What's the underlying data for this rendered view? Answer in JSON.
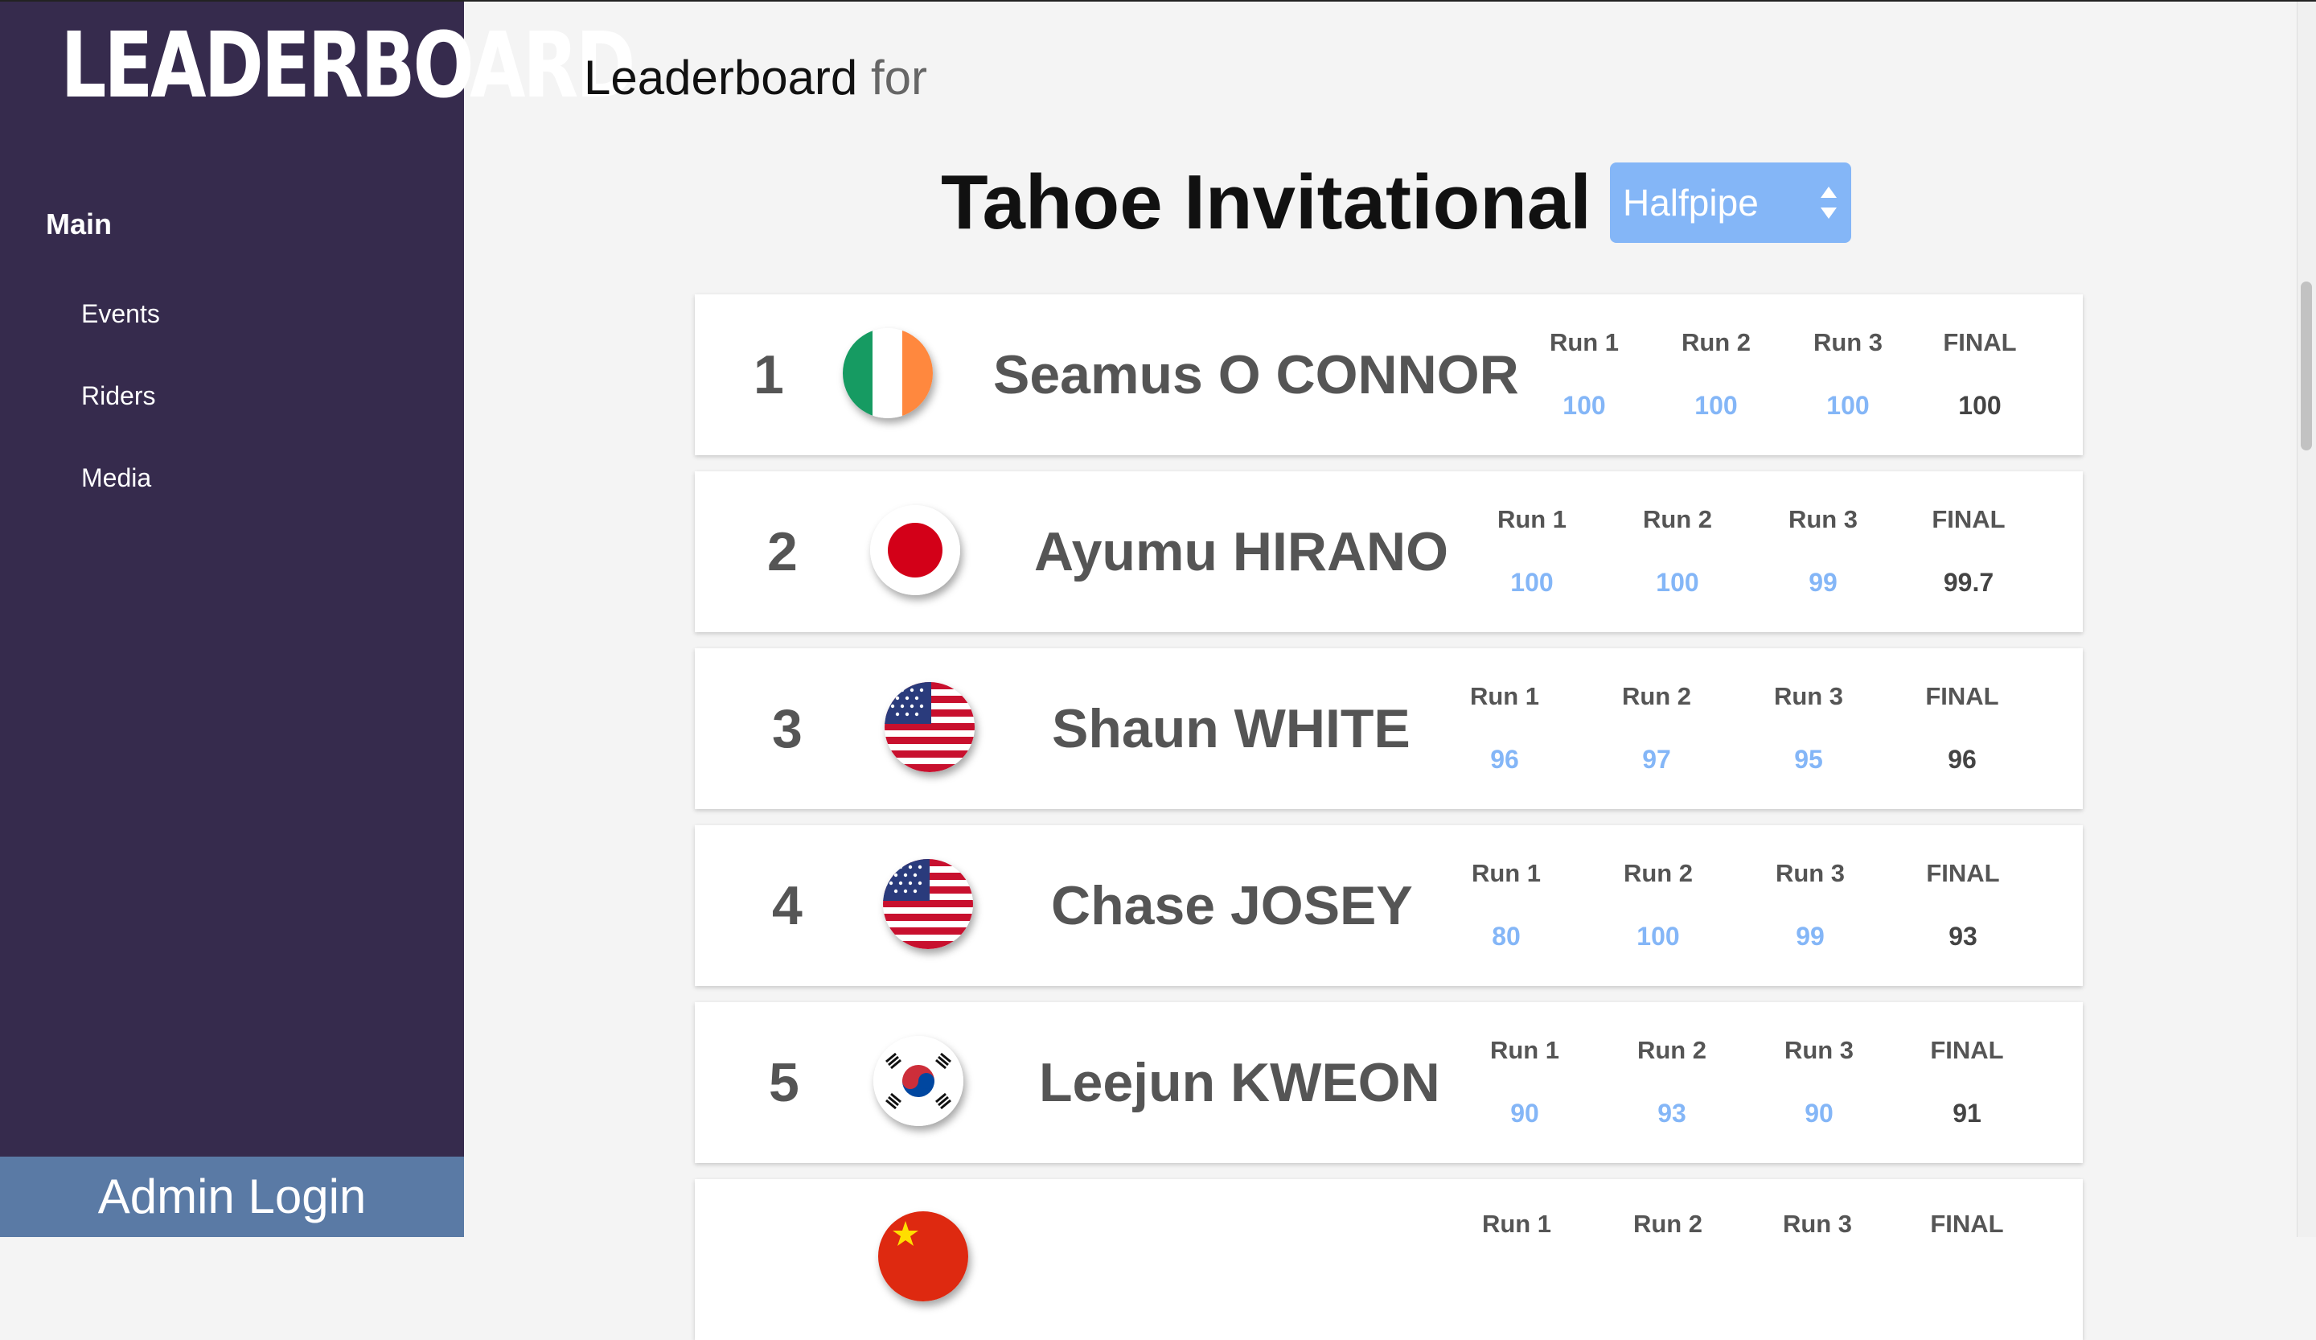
{
  "sidebar": {
    "logo": "LEADERBOARD",
    "main_label": "Main",
    "items": [
      {
        "label": "Events"
      },
      {
        "label": "Riders"
      },
      {
        "label": "Media"
      }
    ],
    "admin_label": "Admin Login"
  },
  "header": {
    "heading": "Leaderboard",
    "heading_for": "for",
    "event_title": "Tahoe Invitational",
    "discipline_select": "Halfpipe"
  },
  "leaderboard": [
    {
      "rank": "1",
      "flag": "ireland-flag-icon",
      "name": "Seamus O CONNOR",
      "runs": [
        {
          "label": "Run 1",
          "score": "100"
        },
        {
          "label": "Run 2",
          "score": "100"
        },
        {
          "label": "Run 3",
          "score": "100"
        },
        {
          "label": "FINAL",
          "score": "100"
        }
      ]
    },
    {
      "rank": "2",
      "flag": "japan-flag-icon",
      "name": "Ayumu HIRANO",
      "runs": [
        {
          "label": "Run 1",
          "score": "100"
        },
        {
          "label": "Run 2",
          "score": "100"
        },
        {
          "label": "Run 3",
          "score": "99"
        },
        {
          "label": "FINAL",
          "score": "99.7"
        }
      ]
    },
    {
      "rank": "3",
      "flag": "usa-flag-icon",
      "name": "Shaun WHITE",
      "runs": [
        {
          "label": "Run 1",
          "score": "96"
        },
        {
          "label": "Run 2",
          "score": "97"
        },
        {
          "label": "Run 3",
          "score": "95"
        },
        {
          "label": "FINAL",
          "score": "96"
        }
      ]
    },
    {
      "rank": "4",
      "flag": "usa-flag-icon",
      "name": "Chase JOSEY",
      "runs": [
        {
          "label": "Run 1",
          "score": "80"
        },
        {
          "label": "Run 2",
          "score": "100"
        },
        {
          "label": "Run 3",
          "score": "99"
        },
        {
          "label": "FINAL",
          "score": "93"
        }
      ]
    },
    {
      "rank": "5",
      "flag": "south-korea-flag-icon",
      "name": "Leejun KWEON",
      "runs": [
        {
          "label": "Run 1",
          "score": "90"
        },
        {
          "label": "Run 2",
          "score": "93"
        },
        {
          "label": "Run 3",
          "score": "90"
        },
        {
          "label": "FINAL",
          "score": "91"
        }
      ]
    },
    {
      "rank": "",
      "flag": "china-flag-icon",
      "name": "",
      "runs": [
        {
          "label": "Run 1",
          "score": ""
        },
        {
          "label": "Run 2",
          "score": ""
        },
        {
          "label": "Run 3",
          "score": ""
        },
        {
          "label": "FINAL",
          "score": ""
        }
      ]
    }
  ],
  "colors": {
    "sidebar_bg": "#362b4d",
    "admin_bg": "#5a7aa5",
    "accent_blue": "#84b6f7",
    "page_bg": "#f4f4f4"
  }
}
